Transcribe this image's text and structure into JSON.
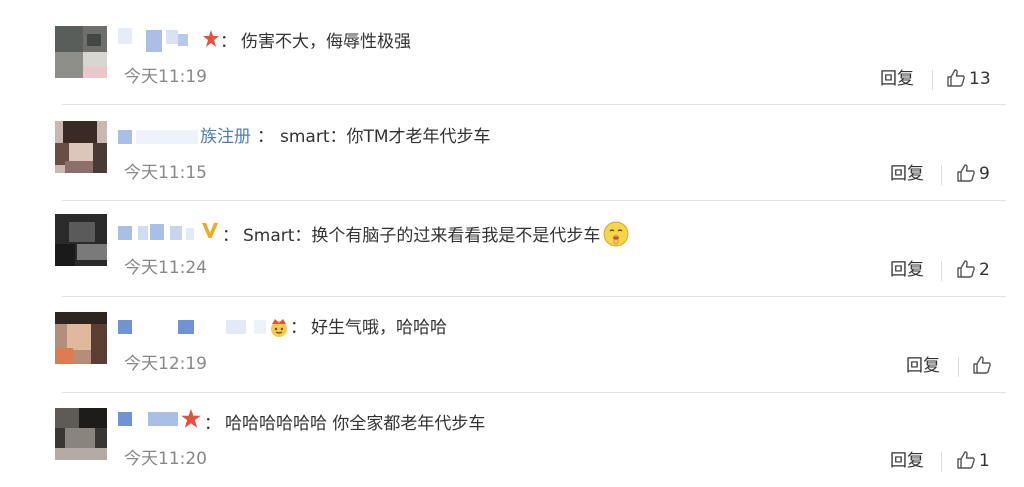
{
  "comments": [
    {
      "user_tail": "",
      "text": "伤害不大，侮辱性极强",
      "time": "今天11:19",
      "reply_label": "回复",
      "likes": "13"
    },
    {
      "user_tail": "族注册",
      "text": "smart：你TM才老年代步车",
      "time": "今天11:15",
      "reply_label": "回复",
      "likes": "9"
    },
    {
      "user_tail": "",
      "text": "Smart：换个有脑子的过来看看我是不是代步车",
      "time": "今天11:24",
      "reply_label": "回复",
      "likes": "2"
    },
    {
      "user_tail": "",
      "text": "好生气哦，哈哈哈",
      "time": "今天12:19",
      "reply_label": "回复",
      "likes": ""
    },
    {
      "user_tail": "",
      "text": "哈哈哈哈哈哈 你全家都老年代步车",
      "time": "今天11:20",
      "reply_label": "回复",
      "likes": "1"
    }
  ],
  "separator": "：",
  "colors": {
    "blur_blue": "#a9bfe6",
    "blur_blue_dark": "#6e93d6",
    "text": "#333333",
    "muted": "#888888",
    "divider": "#e2e2e2",
    "badge_red": "#e8503a",
    "badge_gold": "#f5a623"
  },
  "icons": {
    "like": "thumbs-up-icon",
    "v_badge": "verified-v-icon",
    "star_badge": "red-star-badge-icon",
    "crown_badge": "crown-emoji-icon",
    "emoji": "shushing-face-emoji-icon"
  }
}
